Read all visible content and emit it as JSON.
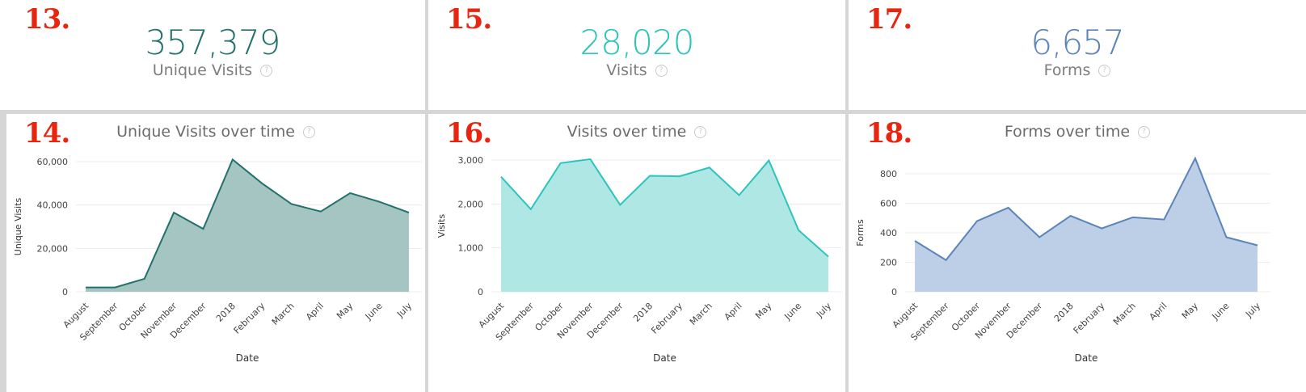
{
  "panels": [
    {
      "number": "13.",
      "value": "357,379",
      "label": "Unique Visits",
      "help": "?",
      "color": "#23716a"
    },
    {
      "number": "15.",
      "value": "28,020",
      "label": "Visits",
      "help": "?",
      "color": "#2cc4bd"
    },
    {
      "number": "17.",
      "value": "6,657",
      "label": "Forms",
      "help": "?",
      "color": "#5b84bb"
    }
  ],
  "chart_panels": [
    {
      "number": "14.",
      "help": "?"
    },
    {
      "number": "16.",
      "help": "?"
    },
    {
      "number": "18.",
      "help": "?"
    }
  ],
  "chart_data": [
    {
      "type": "area",
      "title": "Unique Visits over time",
      "xlabel": "Date",
      "ylabel": "Unique Visits",
      "categories": [
        "August",
        "September",
        "October",
        "November",
        "December",
        "2018",
        "February",
        "March",
        "April",
        "May",
        "June",
        "July"
      ],
      "values": [
        2000,
        2000,
        6000,
        36500,
        29000,
        61000,
        50000,
        40500,
        37000,
        45500,
        41500,
        36500
      ],
      "ylim": [
        0,
        60000
      ],
      "yticks": [
        "0",
        "20,000",
        "40,000",
        "60,000"
      ],
      "grid": true,
      "line_color": "#23716a",
      "fill_color": "#a5c5c2"
    },
    {
      "type": "area",
      "title": "Visits over time",
      "xlabel": "Date",
      "ylabel": "Visits",
      "categories": [
        "August",
        "September",
        "October",
        "November",
        "December",
        "2018",
        "February",
        "March",
        "April",
        "May",
        "June",
        "July"
      ],
      "values": [
        2620,
        1880,
        2930,
        3020,
        1980,
        2640,
        2630,
        2830,
        2200,
        2990,
        1400,
        800
      ],
      "ylim": [
        0,
        3000
      ],
      "yticks": [
        "0",
        "1,000",
        "2,000",
        "3,000"
      ],
      "grid": true,
      "line_color": "#2cc4bd",
      "fill_color": "#aee7e4"
    },
    {
      "type": "area",
      "title": "Forms over time",
      "xlabel": "Date",
      "ylabel": "Forms",
      "categories": [
        "August",
        "September",
        "October",
        "November",
        "December",
        "2018",
        "February",
        "March",
        "April",
        "May",
        "June",
        "July"
      ],
      "values": [
        345,
        215,
        480,
        570,
        370,
        515,
        430,
        505,
        490,
        905,
        370,
        315
      ],
      "ylim": [
        0,
        800
      ],
      "yticks": [
        "0",
        "200",
        "400",
        "600",
        "800"
      ],
      "grid": true,
      "line_color": "#5b84bb",
      "fill_color": "#bccfe6"
    }
  ]
}
